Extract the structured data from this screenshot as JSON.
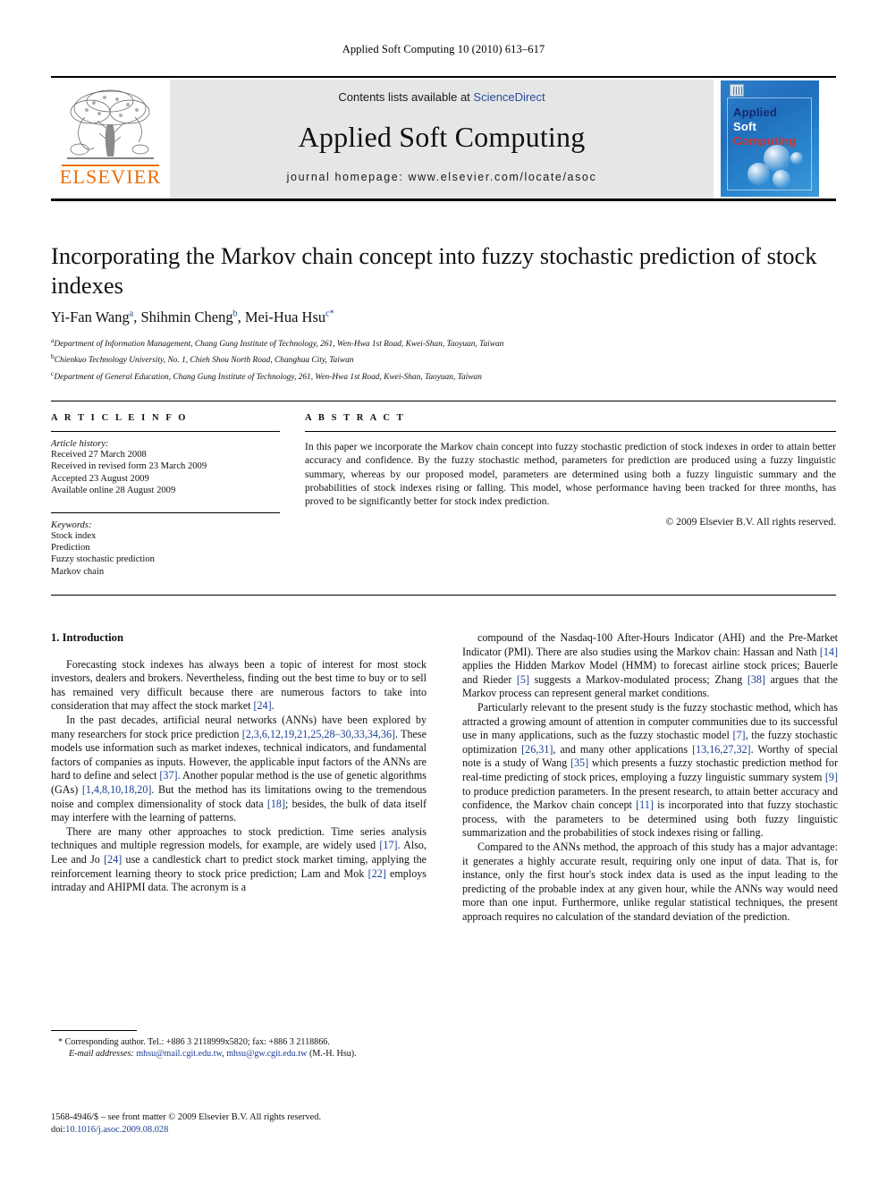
{
  "running_head": "Applied Soft Computing 10 (2010) 613–617",
  "masthead": {
    "contents_prefix": "Contents lists available at ",
    "sciencedirect": "ScienceDirect",
    "journal_title": "Applied Soft Computing",
    "homepage": "journal homepage: www.elsevier.com/locate/asoc",
    "publisher_wordmark": "ELSEVIER",
    "cover": {
      "line1": "Applied",
      "line2": "Soft",
      "line3": "Computing"
    },
    "colors": {
      "elsevier_orange": "#eb6e08",
      "sciencedirect_blue": "#2b4c9b",
      "band_gray": "#e6e6e6",
      "cover_blue": "#2f7fc8",
      "cover_red": "#d8312a"
    }
  },
  "article": {
    "title": "Incorporating the Markov chain concept into fuzzy stochastic prediction of stock indexes",
    "authors": [
      {
        "name": "Yi-Fan Wang",
        "marks": "a"
      },
      {
        "name": "Shihmin Cheng",
        "marks": "b"
      },
      {
        "name": "Mei-Hua Hsu",
        "marks": "c*"
      }
    ],
    "authors_line": "Yi-Fan Wang a, Shihmin Cheng b, Mei-Hua Hsu c*",
    "affiliations": [
      {
        "mark": "a",
        "text": "Department of Information Management, Chang Gung Institute of Technology, 261, Wen-Hwa 1st Road, Kwei-Shan, Taoyuan, Taiwan"
      },
      {
        "mark": "b",
        "text": "Chienkuo Technology University, No. 1, Chieh Shou North Road, Changhua City, Taiwan"
      },
      {
        "mark": "c",
        "text": "Department of General Education, Chang Gung Institute of Technology, 261, Wen-Hwa 1st Road, Kwei-Shan, Taoyuan, Taiwan"
      }
    ]
  },
  "article_info": {
    "heading": "A R T I C L E  I N F O",
    "history_label": "Article history:",
    "history": [
      "Received 27 March 2008",
      "Received in revised form 23 March 2009",
      "Accepted 23 August 2009",
      "Available online 28 August 2009"
    ],
    "keywords_label": "Keywords:",
    "keywords": [
      "Stock index",
      "Prediction",
      "Fuzzy stochastic prediction",
      "Markov chain"
    ]
  },
  "abstract": {
    "heading": "A B S T R A C T",
    "text": "In this paper we incorporate the Markov chain concept into fuzzy stochastic prediction of stock indexes in order to attain better accuracy and confidence. By the fuzzy stochastic method, parameters for prediction are produced using a fuzzy linguistic summary, whereas by our proposed model, parameters are determined using both a fuzzy linguistic summary and the probabilities of stock indexes rising or falling. This model, whose performance having been tracked for three months, has proved to be significantly better for stock index prediction.",
    "copyright": "© 2009 Elsevier B.V. All rights reserved."
  },
  "body": {
    "section_heading": "1. Introduction",
    "left_paragraphs": [
      "Forecasting stock indexes has always been a topic of interest for most stock investors, dealers and brokers. Nevertheless, finding out the best time to buy or to sell has remained very difficult because there are numerous factors to take into consideration that may affect the stock market [24].",
      "In the past decades, artificial neural networks (ANNs) have been explored by many researchers for stock price prediction [2,3,6,12,19,21,25,28–30,33,34,36]. These models use information such as market indexes, technical indicators, and fundamental factors of companies as inputs. However, the applicable input factors of the ANNs are hard to define and select [37]. Another popular method is the use of genetic algorithms (GAs) [1,4,8,10,18,20]. But the method has its limitations owing to the tremendous noise and complex dimensionality of stock data [18]; besides, the bulk of data itself may interfere with the learning of patterns.",
      "There are many other approaches to stock prediction. Time series analysis techniques and multiple regression models, for example, are widely used [17]. Also, Lee and Jo [24] use a candlestick chart to predict stock market timing, applying the reinforcement learning theory to stock price prediction; Lam and Mok [22] employs intraday and AHIPMI data. The acronym is a"
    ],
    "right_paragraphs": [
      "compound of the Nasdaq-100 After-Hours Indicator (AHI) and the Pre-Market Indicator (PMI). There are also studies using the Markov chain: Hassan and Nath [14] applies the Hidden Markov Model (HMM) to forecast airline stock prices; Bauerle and Rieder [5] suggests a Markov-modulated process; Zhang [38] argues that the Markov process can represent general market conditions.",
      "Particularly relevant to the present study is the fuzzy stochastic method, which has attracted a growing amount of attention in computer communities due to its successful use in many applications, such as the fuzzy stochastic model [7], the fuzzy stochastic optimization [26,31], and many other applications [13,16,27,32]. Worthy of special note is a study of Wang [35] which presents a fuzzy stochastic prediction method for real-time predicting of stock prices, employing a fuzzy linguistic summary system [9] to produce prediction parameters. In the present research, to attain better accuracy and confidence, the Markov chain concept [11] is incorporated into that fuzzy stochastic process, with the parameters to be determined using both fuzzy linguistic summarization and the probabilities of stock indexes rising or falling.",
      "Compared to the ANNs method, the approach of this study has a major advantage: it generates a highly accurate result, requiring only one input of data. That is, for instance, only the first hour's stock index data is used as the input leading to the predicting of the probable index at any given hour, while the ANNs way would need more than one input. Furthermore, unlike regular statistical techniques, the present approach requires no calculation of the standard deviation of the prediction."
    ]
  },
  "footnote": {
    "corresponding": "* Corresponding author. Tel.: +886 3 2118999x5820; fax: +886 3 2118866.",
    "email_label": "E-mail addresses:",
    "email1": "mhsu@mail.cgit.edu.tw",
    "email2": "mhsu@gw.cgit.edu.tw",
    "email_suffix": "(M.-H. Hsu)."
  },
  "imprint": {
    "issn_line": "1568-4946/$ – see front matter © 2009 Elsevier B.V. All rights reserved.",
    "doi_label": "doi:",
    "doi_value": "10.1016/j.asoc.2009.08.028"
  }
}
